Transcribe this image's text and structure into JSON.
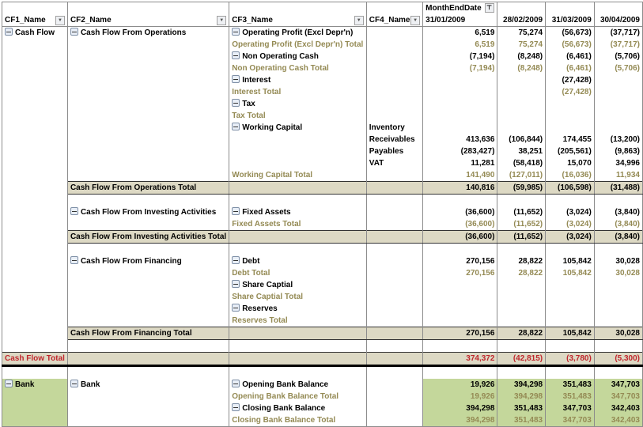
{
  "header": {
    "field_cf1": "CF1_Name",
    "field_cf2": "CF2_Name",
    "field_cf3": "CF3_Name",
    "field_cf4": "CF4_Name",
    "column_field": "MonthEndDate",
    "dates": [
      "31/01/2009",
      "28/02/2009",
      "31/03/2009",
      "30/04/2009"
    ]
  },
  "icons": {
    "dropdown": "▼",
    "filter": "⊤"
  },
  "cf1": {
    "cash_flow": "Cash Flow",
    "cash_flow_total": "Cash Flow Total",
    "bank": "Bank"
  },
  "cf2": {
    "operations": "Cash Flow From Operations",
    "operations_total": "Cash Flow From Operations Total",
    "investing": "Cash Flow From Investing Activities",
    "investing_total": "Cash Flow From Investing Activities Total",
    "financing": "Cash Flow From Financing",
    "financing_total": "Cash Flow From Financing Total",
    "bank": "Bank"
  },
  "cf3": {
    "op_profit": "Operating Profit (Excl Depr'n)",
    "op_profit_total": "Operating Profit (Excl Depr'n) Total",
    "non_op": "Non Operating Cash",
    "non_op_total": "Non Operating Cash Total",
    "interest": "Interest",
    "interest_total": "Interest Total",
    "tax": "Tax",
    "tax_total": "Tax Total",
    "wc": "Working Capital",
    "wc_total": "Working Capital Total",
    "fixed_assets": "Fixed Assets",
    "fixed_assets_total": "Fixed Assets Total",
    "debt": "Debt",
    "debt_total": "Debt Total",
    "share": "Share Captial",
    "share_total": "Share Captial Total",
    "reserves": "Reserves",
    "reserves_total": "Reserves Total",
    "opening": "Opening Bank Balance",
    "opening_total": "Opening Bank Balance Total",
    "closing": "Closing Bank Balance",
    "closing_total": "Closing Bank Balance Total"
  },
  "cf4": {
    "inventory": "Inventory",
    "receivables": "Receivables",
    "payables": "Payables",
    "vat": "VAT"
  },
  "values": {
    "op_profit": [
      "6,519",
      "75,274",
      "(56,673)",
      "(37,717)"
    ],
    "op_profit_total": [
      "6,519",
      "75,274",
      "(56,673)",
      "(37,717)"
    ],
    "non_op": [
      "(7,194)",
      "(8,248)",
      "(6,461)",
      "(5,706)"
    ],
    "non_op_total": [
      "(7,194)",
      "(8,248)",
      "(6,461)",
      "(5,706)"
    ],
    "interest": [
      "",
      "",
      "(27,428)",
      ""
    ],
    "interest_total": [
      "",
      "",
      "(27,428)",
      ""
    ],
    "inventory": [
      "",
      "",
      "",
      ""
    ],
    "receivables": [
      "413,636",
      "(106,844)",
      "174,455",
      "(13,200)"
    ],
    "payables": [
      "(283,427)",
      "38,251",
      "(205,561)",
      "(9,863)"
    ],
    "vat": [
      "11,281",
      "(58,418)",
      "15,070",
      "34,996"
    ],
    "wc_total": [
      "141,490",
      "(127,011)",
      "(16,036)",
      "11,934"
    ],
    "operations_total": [
      "140,816",
      "(59,985)",
      "(106,598)",
      "(31,488)"
    ],
    "fixed_assets": [
      "(36,600)",
      "(11,652)",
      "(3,024)",
      "(3,840)"
    ],
    "fixed_assets_total": [
      "(36,600)",
      "(11,652)",
      "(3,024)",
      "(3,840)"
    ],
    "investing_total": [
      "(36,600)",
      "(11,652)",
      "(3,024)",
      "(3,840)"
    ],
    "debt": [
      "270,156",
      "28,822",
      "105,842",
      "30,028"
    ],
    "debt_total": [
      "270,156",
      "28,822",
      "105,842",
      "30,028"
    ],
    "financing_total": [
      "270,156",
      "28,822",
      "105,842",
      "30,028"
    ],
    "cash_flow_total": [
      "374,372",
      "(42,815)",
      "(3,780)",
      "(5,300)"
    ],
    "opening": [
      "19,926",
      "394,298",
      "351,483",
      "347,703"
    ],
    "opening_total": [
      "19,926",
      "394,298",
      "351,483",
      "347,703"
    ],
    "closing": [
      "394,298",
      "351,483",
      "347,703",
      "342,403"
    ],
    "closing_total": [
      "394,298",
      "351,483",
      "347,703",
      "342,403"
    ]
  }
}
